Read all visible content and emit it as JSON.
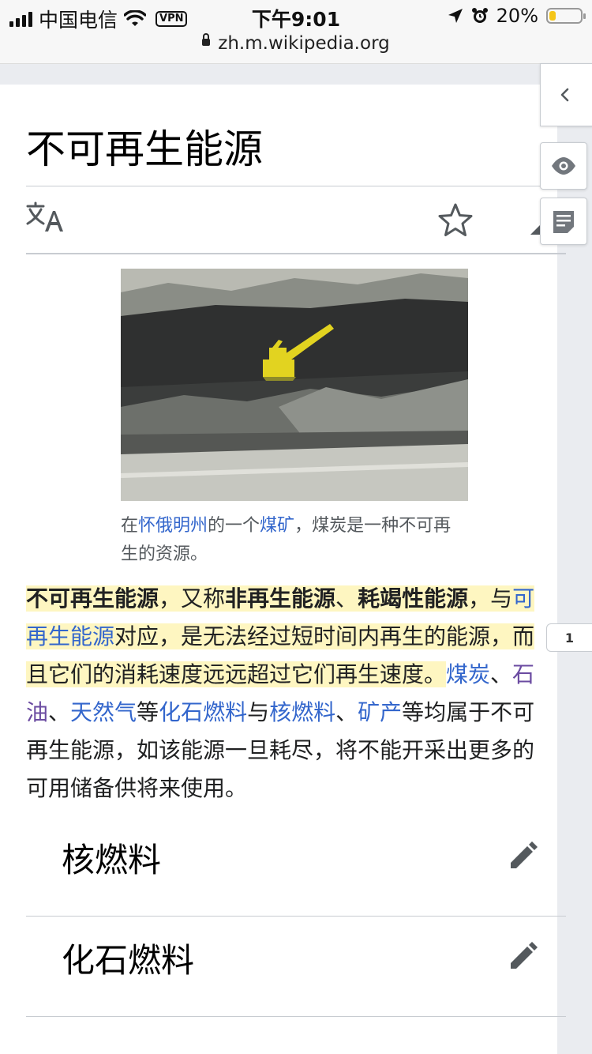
{
  "status_bar": {
    "carrier": "中国电信",
    "vpn": "VPN",
    "time": "下午9:01",
    "battery": "20%",
    "battery_level": 0.2
  },
  "browser": {
    "url": "zh.m.wikipedia.org"
  },
  "article": {
    "title": "不可再生能源",
    "image_caption": {
      "prefix": "在",
      "link1": "怀俄明州",
      "mid": "的一个",
      "link2": "煤矿",
      "suffix": "，煤炭是一种不可再生的资源。"
    },
    "lead": {
      "t_bold1": "不可再生能源",
      "t1": "，又称",
      "t_bold2": "非再生能源",
      "t2": "、",
      "t_bold3": "耗竭性能源",
      "t3": "，与",
      "link_renewable": "可再生能源",
      "t4": "对应，是无法经过短时间内再生的能源，而且它们的消耗速度远远超过它们再生速度。",
      "link_coal": "煤炭",
      "sep1": "、",
      "link_oil": "石油",
      "sep2": "、",
      "link_gas": "天然气",
      "t5": "等",
      "link_fossil": "化石燃料",
      "t6": "与",
      "link_nuclear": "核燃料",
      "sep3": "、",
      "link_mineral": "矿产",
      "t7": "等均属于不可再生能源，如该能源一旦耗尽，将不能开采出更多的可用储备供将来使用。"
    },
    "annotation_badge": "1",
    "sections": [
      {
        "title": "核燃料"
      },
      {
        "title": "化石燃料"
      }
    ]
  },
  "icons": {
    "language": "language-icon",
    "watch": "star-icon",
    "edit": "pencil-icon",
    "collapse": "chevron-left-icon",
    "eye": "eye-icon",
    "notes": "notes-icon"
  }
}
